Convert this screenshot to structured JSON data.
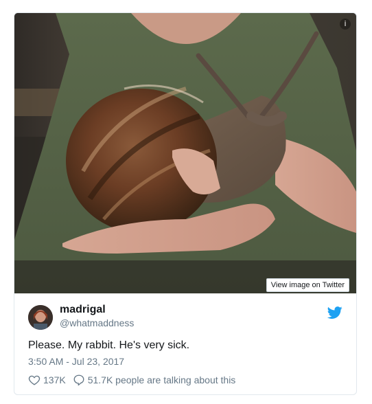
{
  "tweet": {
    "display_name": "madrigal",
    "handle": "@whatmaddness",
    "text": "Please. My rabbit. He's very sick.",
    "timestamp": "3:50 AM - Jul 23, 2017",
    "likes": "137K",
    "replies": "51.7K people are talking about this"
  },
  "media": {
    "view_label": "View image on Twitter",
    "info_glyph": "i"
  },
  "icons": {
    "info": "info-icon",
    "twitter": "twitter-bird-icon",
    "heart": "heart-icon",
    "comment": "comment-icon"
  },
  "colors": {
    "twitter_blue": "#1da1f2",
    "text_primary": "#14171a",
    "text_secondary": "#657786",
    "border": "#e1e8ed"
  }
}
